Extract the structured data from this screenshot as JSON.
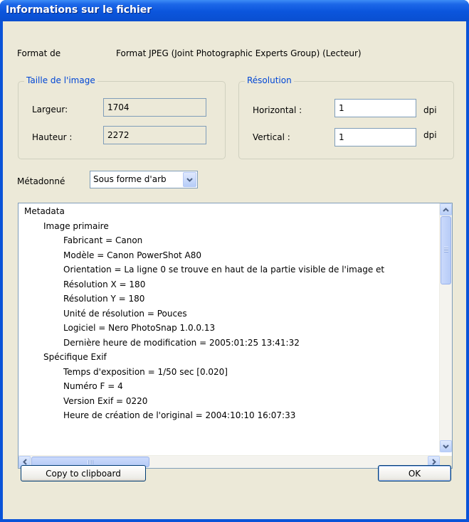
{
  "window": {
    "title": "Informations sur le fichier"
  },
  "format": {
    "label": "Format de",
    "value": "Format JPEG (Joint Photographic Experts Group) (Lecteur)"
  },
  "image_size": {
    "legend": "Taille de l'image",
    "width_label": "Largeur:",
    "width_value": "1704",
    "height_label": "Hauteur :",
    "height_value": "2272"
  },
  "resolution": {
    "legend": "Résolution",
    "horizontal_label": "Horizontal :",
    "horizontal_value": "1",
    "horizontal_unit": "dpi",
    "vertical_label": "Vertical :",
    "vertical_value": "1",
    "vertical_unit": "dpi"
  },
  "metadata": {
    "label": "Métadonné",
    "view_selected": "Sous forme d'arb",
    "tree": [
      {
        "text": "Metadata",
        "level": 0
      },
      {
        "text": "Image primaire",
        "level": 1
      },
      {
        "text": "Fabricant = Canon",
        "level": 2
      },
      {
        "text": "Modèle = Canon PowerShot A80",
        "level": 2
      },
      {
        "text": "Orientation = La ligne 0 se trouve en haut de la partie visible de l'image et",
        "level": 2
      },
      {
        "text": "Résolution X = 180",
        "level": 2
      },
      {
        "text": "Résolution Y = 180",
        "level": 2
      },
      {
        "text": "Unité de résolution = Pouces",
        "level": 2
      },
      {
        "text": "Logiciel = Nero PhotoSnap 1.0.0.13",
        "level": 2
      },
      {
        "text": "Dernière heure de modification = 2005:01:25 13:41:32",
        "level": 2
      },
      {
        "text": "Spécifique Exif",
        "level": 1
      },
      {
        "text": "Temps d'exposition = 1/50 sec  [0.020]",
        "level": 2
      },
      {
        "text": "Numéro F = 4",
        "level": 2
      },
      {
        "text": "Version Exif = 0220",
        "level": 2
      },
      {
        "text": "Heure de création de l'original = 2004:10:10 16:07:33",
        "level": 2
      }
    ]
  },
  "buttons": {
    "copy": "Copy to clipboard",
    "ok": "OK"
  },
  "colors": {
    "title_bar": "#0a53d8",
    "dialog_bg": "#ece9d8",
    "group_legend": "#0046d5",
    "field_border": "#7f9db9"
  }
}
